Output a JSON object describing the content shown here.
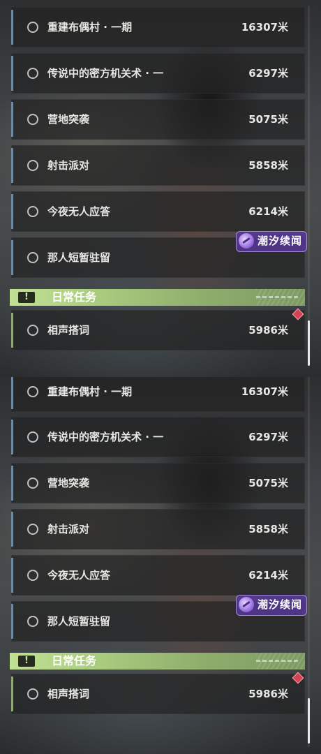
{
  "panels": [
    {
      "quests": [
        {
          "title": "重建布偶村 · 一期",
          "distance": "16307米"
        },
        {
          "title": "传说中的密方机关术 · 一",
          "distance": "6297米"
        },
        {
          "title": "营地突袭",
          "distance": "5075米"
        },
        {
          "title": "射击派对",
          "distance": "5858米"
        },
        {
          "title": "今夜无人应答",
          "distance": "6214米"
        },
        {
          "title": "那人短暂驻留",
          "distance": ""
        }
      ],
      "daily_header": {
        "label": "日常任务",
        "icon": "exclamation-icon"
      },
      "daily_quest": {
        "title": "相声搭词",
        "distance": "5986米"
      },
      "watermark": {
        "text": "潮汐续闻"
      }
    },
    {
      "quests": [
        {
          "title": "重建布偶村 · 一期",
          "distance": "16307米"
        },
        {
          "title": "传说中的密方机关术 · 一",
          "distance": "6297米"
        },
        {
          "title": "营地突袭",
          "distance": "5075米"
        },
        {
          "title": "射击派对",
          "distance": "5858米"
        },
        {
          "title": "今夜无人应答",
          "distance": "6214米"
        },
        {
          "title": "那人短暂驻留",
          "distance": ""
        }
      ],
      "daily_header": {
        "label": "日常任务",
        "icon": "exclamation-icon"
      },
      "daily_quest": {
        "title": "相声搭词",
        "distance": "5986米"
      },
      "watermark": {
        "text": "潮汐续闻"
      }
    }
  ],
  "colors": {
    "main_quest_accent": "#6f8aa0",
    "daily_accent": "#8fa876",
    "daily_header_green": "#a9cc7e",
    "notification_red": "#d44355"
  }
}
